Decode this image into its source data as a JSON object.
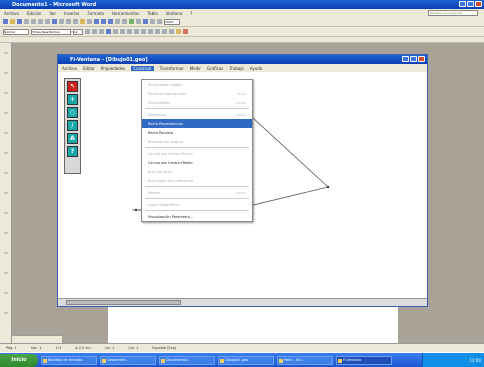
{
  "outer_window": {
    "title": "Documento1 - Microsoft Word",
    "menus": [
      "Archivo",
      "Edición",
      "Ver",
      "Insertar",
      "Formato",
      "Herramientas",
      "Tabla",
      "Ventana",
      "?"
    ],
    "help_placeholder": "Escriba una pregunta",
    "style_box": "Normal",
    "font_box": "Times New Roman",
    "size_box": "12",
    "zoom": "100%"
  },
  "inner_window": {
    "title": "Fi-Ventana - [Dibujo01.geo]",
    "menus": [
      "Archivo",
      "Editar",
      "Propiedades",
      "Construir",
      "Transformar",
      "Medir",
      "Gráficos",
      "Trabajo",
      "Ayuda"
    ],
    "active_menu": "Construir"
  },
  "construir_menu": {
    "items": [
      {
        "label": "Punto sobre Objeto",
        "shortcut": "",
        "enabled": false
      },
      {
        "label": "Punto de Intersección",
        "shortcut": "Ctrl+I",
        "enabled": false
      },
      {
        "label": "Punto Medio",
        "shortcut": "Ctrl+M",
        "enabled": false
      },
      {
        "label": "Segmento",
        "shortcut": "Ctrl+L",
        "enabled": false
      },
      {
        "label": "Recta Perpendicular",
        "shortcut": "",
        "enabled": true,
        "highlighted": true
      },
      {
        "label": "Recta Paralela",
        "shortcut": "",
        "enabled": true
      },
      {
        "label": "Bisectriz del Ángulo",
        "shortcut": "",
        "enabled": false
      },
      {
        "label": "Círculo por Centro+Punto",
        "shortcut": "",
        "enabled": false
      },
      {
        "label": "Círculo por Centro+Radio",
        "shortcut": "",
        "enabled": true
      },
      {
        "label": "Arco por Arco",
        "shortcut": "",
        "enabled": false
      },
      {
        "label": "Arco sobre Circunferencia",
        "shortcut": "",
        "enabled": false
      },
      {
        "label": "Interior",
        "shortcut": "Ctrl+P",
        "enabled": false
      },
      {
        "label": "Lugar Geométrico",
        "shortcut": "",
        "enabled": false
      },
      {
        "label": "Visualización Parámetro...",
        "shortcut": "",
        "enabled": true
      }
    ]
  },
  "palette": {
    "tools": [
      "arrow-tool",
      "point-tool",
      "circle-tool",
      "segment-tool",
      "text-tool",
      "info-tool"
    ]
  },
  "status_bar": {
    "page": "Pág. 1",
    "sec": "Sec. 1",
    "pos": "1/1",
    "at": "A 2,5 cm",
    "line": "Lín. 1",
    "col": "Col. 1",
    "lang": "Español (Esp)"
  },
  "taskbar": {
    "start_label": "Inicio",
    "tasks": [
      "Bandeja de entrada",
      "Geometría...",
      "Documento1",
      "Dibujo01.geo",
      "Paint - Sin...",
      "Fi-Ventana"
    ],
    "clock": "12:00"
  }
}
